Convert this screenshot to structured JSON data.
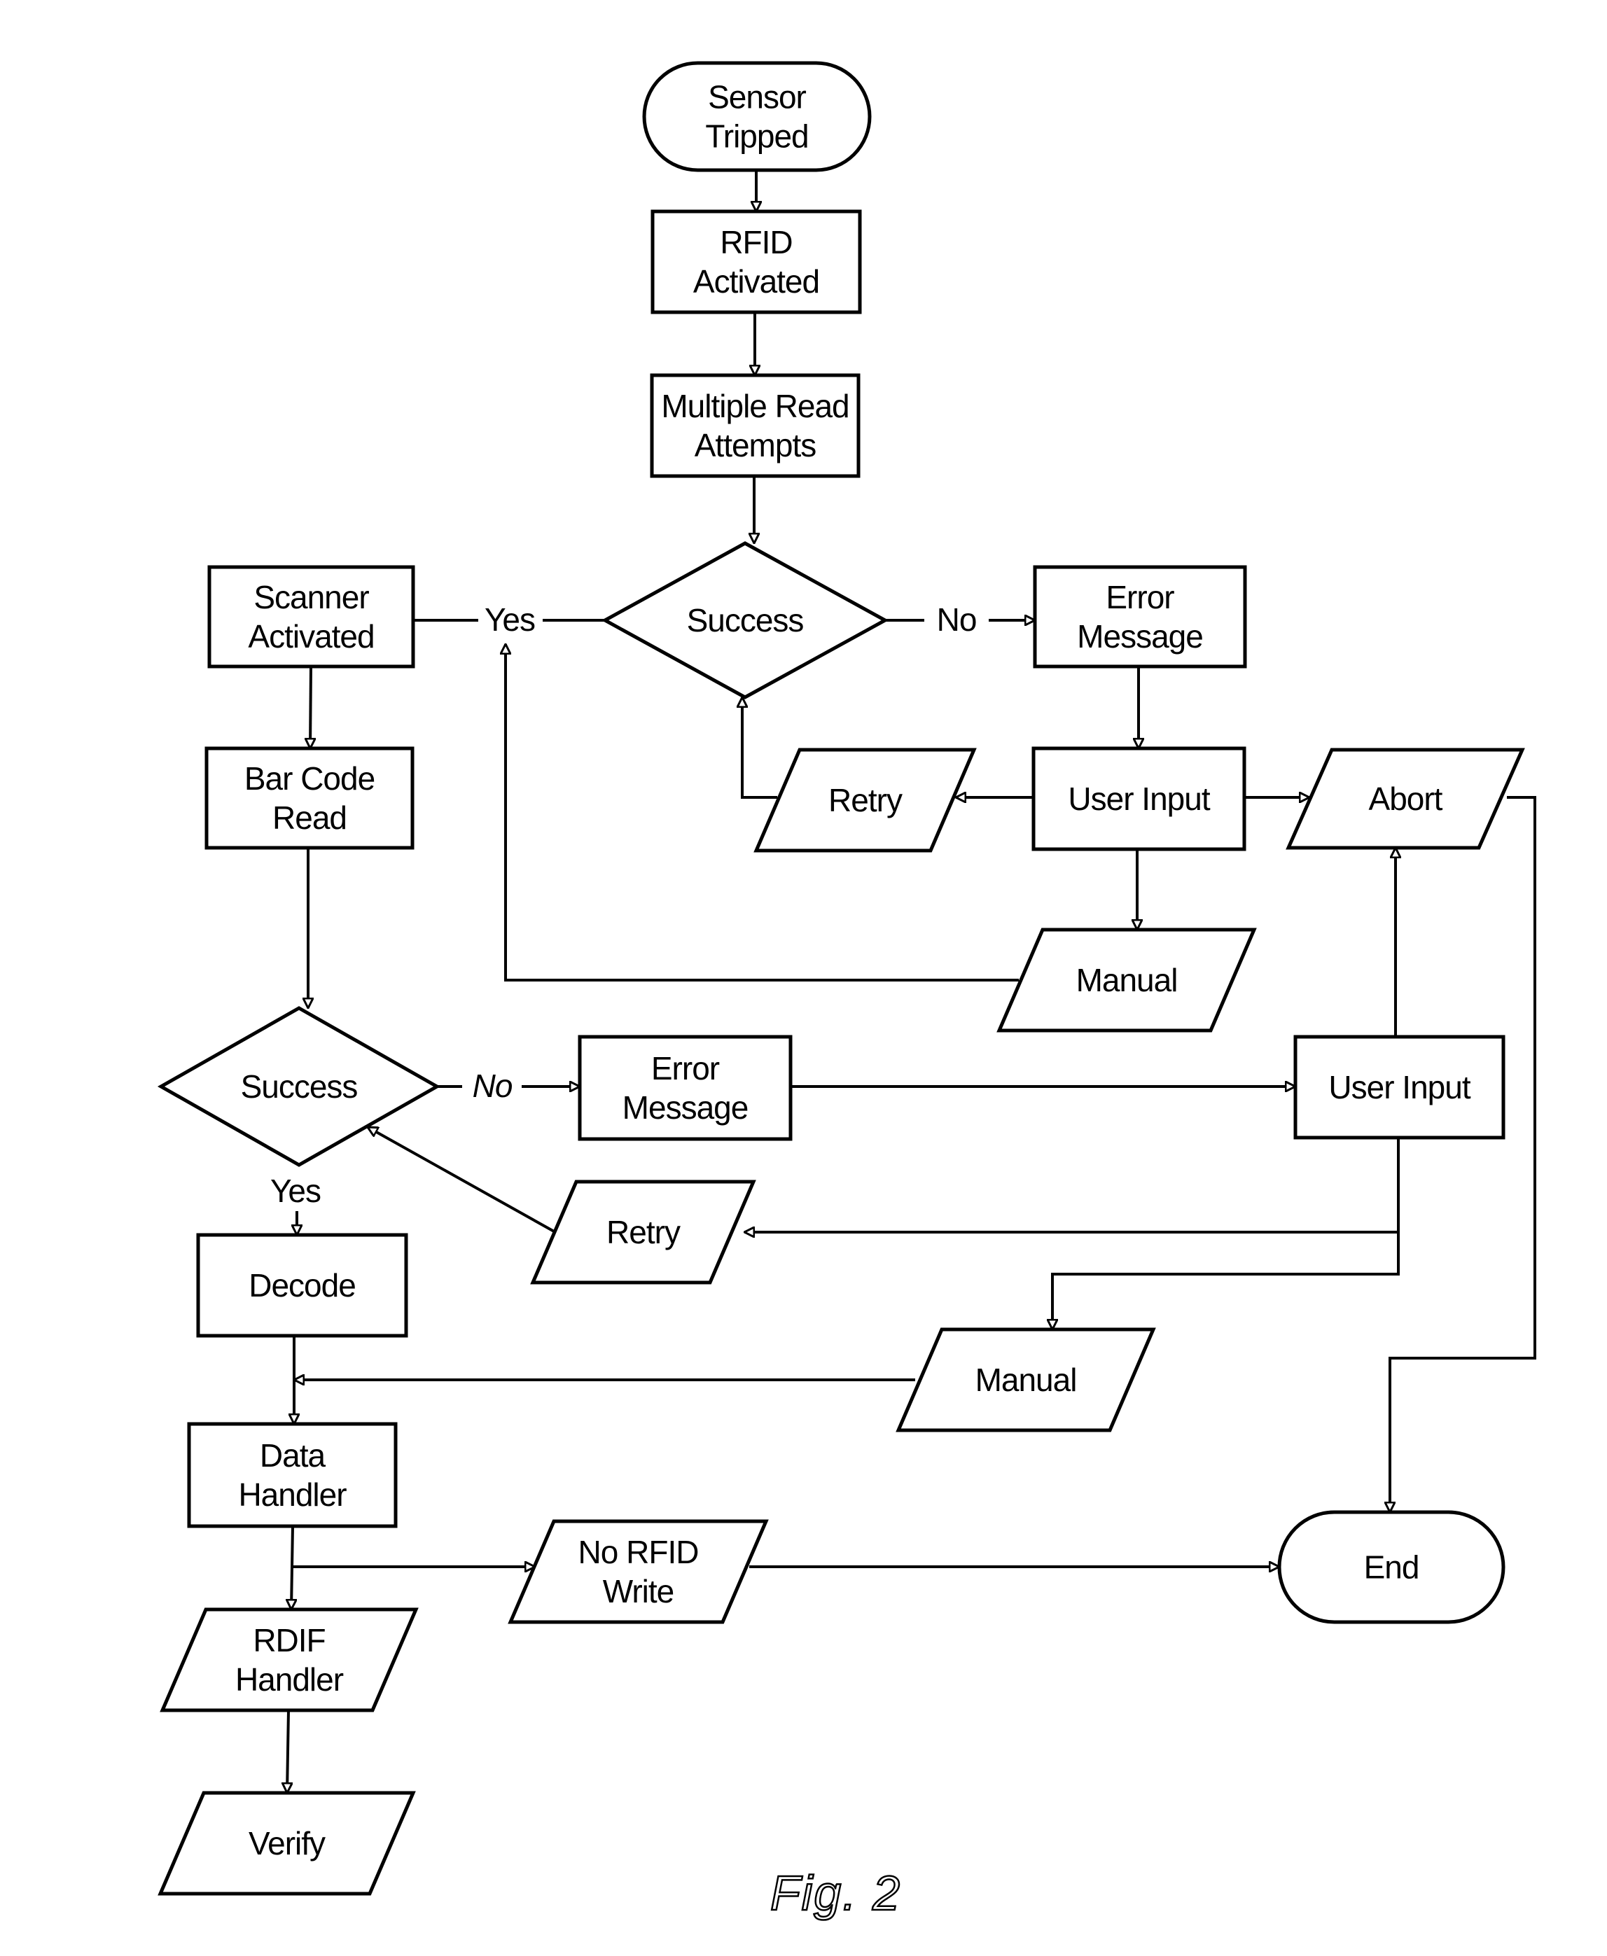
{
  "figure": {
    "caption": "Fig. 2",
    "colors": {
      "line": "#000000",
      "fill": "#ffffff",
      "background": "#ffffff"
    }
  },
  "nodes": [
    {
      "id": "sensor_tripped",
      "shape": "terminator",
      "lines": [
        "Sensor",
        "Tripped"
      ]
    },
    {
      "id": "rfid_activated",
      "shape": "process",
      "lines": [
        "RFID",
        "Activated"
      ]
    },
    {
      "id": "multiple_read_attempts",
      "shape": "process",
      "lines": [
        "Multiple Read",
        "Attempts"
      ]
    },
    {
      "id": "success_rfid",
      "shape": "decision",
      "lines": [
        "Success"
      ]
    },
    {
      "id": "scanner_activated",
      "shape": "process",
      "lines": [
        "Scanner",
        "Activated"
      ]
    },
    {
      "id": "error_message_rfid",
      "shape": "process",
      "lines": [
        "Error",
        "Message"
      ]
    },
    {
      "id": "bar_code_read",
      "shape": "process",
      "lines": [
        "Bar Code",
        "Read"
      ]
    },
    {
      "id": "retry_rfid",
      "shape": "io",
      "lines": [
        "Retry"
      ]
    },
    {
      "id": "user_input_rfid",
      "shape": "process",
      "lines": [
        "User Input"
      ]
    },
    {
      "id": "abort",
      "shape": "io",
      "lines": [
        "Abort"
      ]
    },
    {
      "id": "manual_rfid",
      "shape": "io",
      "lines": [
        "Manual"
      ]
    },
    {
      "id": "success_barcode",
      "shape": "decision",
      "lines": [
        "Success"
      ]
    },
    {
      "id": "error_message_barcode",
      "shape": "process",
      "lines": [
        "Error",
        "Message"
      ]
    },
    {
      "id": "user_input_barcode",
      "shape": "process",
      "lines": [
        "User Input"
      ]
    },
    {
      "id": "retry_barcode",
      "shape": "io",
      "lines": [
        "Retry"
      ]
    },
    {
      "id": "decode",
      "shape": "process",
      "lines": [
        "Decode"
      ]
    },
    {
      "id": "manual_barcode",
      "shape": "io",
      "lines": [
        "Manual"
      ]
    },
    {
      "id": "data_handler",
      "shape": "process",
      "lines": [
        "Data",
        "Handler"
      ]
    },
    {
      "id": "no_rfid_write",
      "shape": "io",
      "lines": [
        "No RFID",
        "Write"
      ]
    },
    {
      "id": "end",
      "shape": "terminator",
      "lines": [
        "End"
      ]
    },
    {
      "id": "rdif_handler",
      "shape": "io",
      "lines": [
        "RDIF",
        "Handler"
      ]
    },
    {
      "id": "verify",
      "shape": "io",
      "lines": [
        "Verify"
      ]
    }
  ],
  "edges": [
    {
      "id": "e1",
      "from": "sensor_tripped",
      "to": "rfid_activated",
      "label": ""
    },
    {
      "id": "e2",
      "from": "rfid_activated",
      "to": "multiple_read_attempts",
      "label": ""
    },
    {
      "id": "e3",
      "from": "multiple_read_attempts",
      "to": "success_rfid",
      "label": ""
    },
    {
      "id": "e4",
      "from": "success_rfid",
      "to": "scanner_activated",
      "label": "Yes"
    },
    {
      "id": "e5",
      "from": "success_rfid",
      "to": "error_message_rfid",
      "label": "No"
    },
    {
      "id": "e6",
      "from": "error_message_rfid",
      "to": "user_input_rfid",
      "label": ""
    },
    {
      "id": "e7",
      "from": "user_input_rfid",
      "to": "retry_rfid",
      "label": ""
    },
    {
      "id": "e8",
      "from": "retry_rfid",
      "to": "success_rfid",
      "label": ""
    },
    {
      "id": "e9",
      "from": "user_input_rfid",
      "to": "abort",
      "label": ""
    },
    {
      "id": "e10",
      "from": "user_input_rfid",
      "to": "manual_rfid",
      "label": ""
    },
    {
      "id": "e11",
      "from": "manual_rfid",
      "to": "scanner_activated",
      "label": ""
    },
    {
      "id": "e12",
      "from": "scanner_activated",
      "to": "bar_code_read",
      "label": ""
    },
    {
      "id": "e13",
      "from": "bar_code_read",
      "to": "success_barcode",
      "label": ""
    },
    {
      "id": "e14",
      "from": "success_barcode",
      "to": "error_message_barcode",
      "label": "No"
    },
    {
      "id": "e15",
      "from": "error_message_barcode",
      "to": "user_input_barcode",
      "label": ""
    },
    {
      "id": "e16",
      "from": "user_input_barcode",
      "to": "abort",
      "label": ""
    },
    {
      "id": "e17",
      "from": "user_input_barcode",
      "to": "retry_barcode",
      "label": ""
    },
    {
      "id": "e18",
      "from": "retry_barcode",
      "to": "success_barcode",
      "label": ""
    },
    {
      "id": "e19",
      "from": "user_input_barcode",
      "to": "manual_barcode",
      "label": ""
    },
    {
      "id": "e20",
      "from": "success_barcode",
      "to": "decode",
      "label": "Yes"
    },
    {
      "id": "e21",
      "from": "decode",
      "to": "data_handler",
      "label": ""
    },
    {
      "id": "e22",
      "from": "manual_barcode",
      "to": "data_handler",
      "label": ""
    },
    {
      "id": "e23",
      "from": "abort",
      "to": "end",
      "label": ""
    },
    {
      "id": "e24",
      "from": "data_handler",
      "to": "no_rfid_write",
      "label": ""
    },
    {
      "id": "e25",
      "from": "no_rfid_write",
      "to": "end",
      "label": ""
    },
    {
      "id": "e26",
      "from": "data_handler",
      "to": "rdif_handler",
      "label": ""
    },
    {
      "id": "e27",
      "from": "rdif_handler",
      "to": "verify",
      "label": ""
    }
  ],
  "edge_labels": {
    "yes_rfid": "Yes",
    "no_rfid": "No",
    "no_barcode": "No",
    "yes_barcode": "Yes"
  }
}
